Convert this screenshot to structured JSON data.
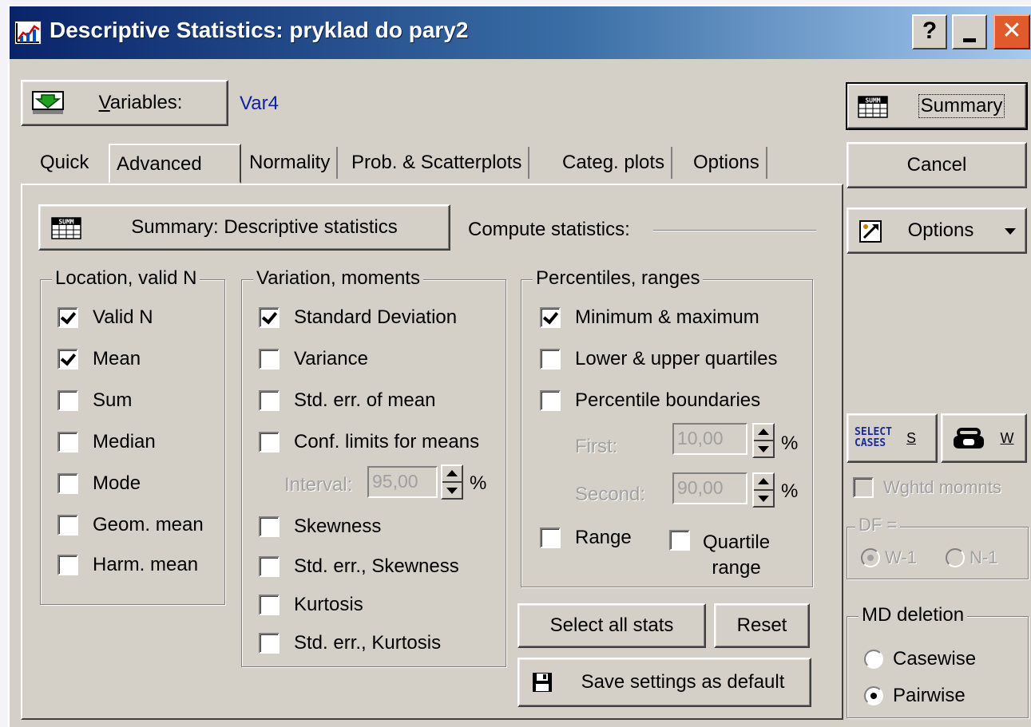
{
  "window": {
    "title": "Descriptive Statistics: pryklad do pary2",
    "help_label": "?",
    "minimize_label": "_",
    "close_label": "✕"
  },
  "variables": {
    "button_label": "Variables:",
    "button_mnemonic": "V",
    "selected": "Var4"
  },
  "tabs": [
    {
      "label": "Quick",
      "active": false
    },
    {
      "label": "Advanced",
      "active": true
    },
    {
      "label": "Normality",
      "active": false
    },
    {
      "label": "Prob. & Scatterplots",
      "active": false
    },
    {
      "label": "Categ. plots",
      "active": false
    },
    {
      "label": "Options",
      "active": false
    }
  ],
  "advanced": {
    "summary_button": "Summary: Descriptive statistics",
    "compute_label": "Compute statistics:",
    "location_group": {
      "title": "Location, valid N",
      "items": [
        {
          "label": "Valid N",
          "checked": true
        },
        {
          "label": "Mean",
          "checked": true
        },
        {
          "label": "Sum",
          "checked": false
        },
        {
          "label": "Median",
          "checked": false
        },
        {
          "label": "Mode",
          "checked": false
        },
        {
          "label": "Geom. mean",
          "checked": false
        },
        {
          "label": "Harm. mean",
          "checked": false
        }
      ]
    },
    "variation_group": {
      "title": "Variation, moments",
      "items": [
        {
          "label": "Standard Deviation",
          "checked": true
        },
        {
          "label": "Variance",
          "checked": false
        },
        {
          "label": "Std. err. of mean",
          "checked": false
        },
        {
          "label": "Conf. limits for means",
          "checked": false
        },
        {
          "label": "Skewness",
          "checked": false
        },
        {
          "label": "Std. err., Skewness",
          "checked": false
        },
        {
          "label": "Kurtosis",
          "checked": false
        },
        {
          "label": "Std. err., Kurtosis",
          "checked": false
        }
      ],
      "interval_label": "Interval:",
      "interval_value": "95,00",
      "percent": "%"
    },
    "percentiles_group": {
      "title": "Percentiles, ranges",
      "items": [
        {
          "label": "Minimum & maximum",
          "checked": true
        },
        {
          "label": "Lower & upper quartiles",
          "checked": false
        },
        {
          "label": "Percentile boundaries",
          "checked": false
        }
      ],
      "first_label": "First:",
      "first_value": "10,00",
      "second_label": "Second:",
      "second_value": "90,00",
      "percent": "%",
      "range_label": "Range",
      "range_checked": false,
      "quartile_range_label_1": "Quartile",
      "quartile_range_label_2": "range",
      "quartile_range_checked": false
    },
    "select_all_button": "Select all stats",
    "reset_button": "Reset",
    "save_default_button": "Save settings as default"
  },
  "right_panel": {
    "summary_button": "Summary",
    "cancel_button": "Cancel",
    "options_button": "Options",
    "select_cases_icon_text_1": "SELECT",
    "select_cases_icon_text_2": "CASES",
    "select_cases_mnemonic": "S",
    "weight_mnemonic": "W",
    "wghtd_momnts_label": "Wghtd momnts",
    "wghtd_momnts_checked": false,
    "df_title": "DF =",
    "df_options": [
      {
        "label": "W-1",
        "selected": true
      },
      {
        "label": "N-1",
        "selected": false
      }
    ],
    "md_deletion_title": "MD deletion",
    "md_options": [
      {
        "label": "Casewise",
        "selected": false
      },
      {
        "label": "Pairwise",
        "selected": true
      }
    ]
  }
}
